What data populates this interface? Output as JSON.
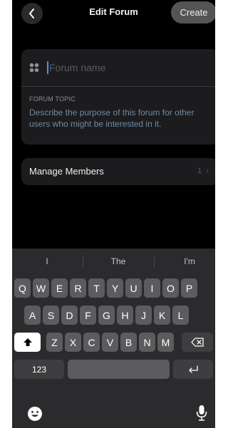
{
  "header": {
    "title": "Edit Forum",
    "create_label": "Create"
  },
  "forum": {
    "name_placeholder": "Forum name",
    "topic_label": "FORUM TOPIC",
    "topic_placeholder": "Describe the purpose of this forum for other users who might be interested in it."
  },
  "members": {
    "label": "Manage Members",
    "count": "1"
  },
  "keyboard": {
    "suggestions": [
      "I",
      "The",
      "I'm"
    ],
    "row1": [
      "Q",
      "W",
      "E",
      "R",
      "T",
      "Y",
      "U",
      "I",
      "O",
      "P"
    ],
    "row2": [
      "A",
      "S",
      "D",
      "F",
      "G",
      "H",
      "J",
      "K",
      "L"
    ],
    "row3": [
      "Z",
      "X",
      "C",
      "V",
      "B",
      "N",
      "M"
    ],
    "numbers_label": "123"
  },
  "colors": {
    "background": "#000000",
    "card": "#1c1c1e",
    "accent_caret": "#4f8fe8",
    "key": "#5c5c5e"
  },
  "icons": [
    "chevron-left-icon",
    "forum-grid-icon",
    "chevron-right-icon",
    "shift-icon",
    "backspace-icon",
    "return-icon",
    "emoji-icon",
    "microphone-icon"
  ]
}
